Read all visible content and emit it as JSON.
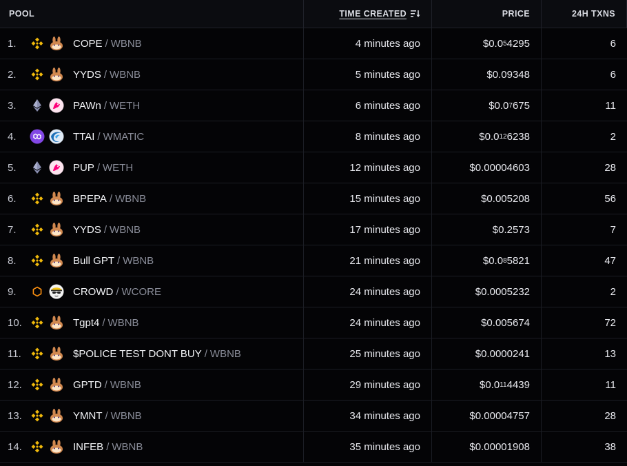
{
  "header": {
    "pool": "POOL",
    "time_created": "TIME CREATED",
    "price": "PRICE",
    "txns": "24H TXNS"
  },
  "colors": {
    "bnb": "#F0B90B",
    "eth": "#7b7f9a",
    "polygon": "#8247E5",
    "core": "#FF9211",
    "pancake": "#D1884F"
  },
  "rows": [
    {
      "rank": "1.",
      "chain_icon": "bnb-icon",
      "dex_icon": "pancakeswap-icon",
      "base": "COPE",
      "quote": "WBNB",
      "time": "4 minutes ago",
      "price_pre": "$0.0",
      "price_sub": "5",
      "price_post": "4295",
      "txns": "6"
    },
    {
      "rank": "2.",
      "chain_icon": "bnb-icon",
      "dex_icon": "pancakeswap-icon",
      "base": "YYDS",
      "quote": "WBNB",
      "time": "5 minutes ago",
      "price_pre": "$0.09348",
      "price_sub": "",
      "price_post": "",
      "txns": "6"
    },
    {
      "rank": "3.",
      "chain_icon": "ethereum-icon",
      "dex_icon": "uniswap-icon",
      "base": "PAWn",
      "quote": "WETH",
      "time": "6 minutes ago",
      "price_pre": "$0.0",
      "price_sub": "7",
      "price_post": "675",
      "txns": "11"
    },
    {
      "rank": "4.",
      "chain_icon": "polygon-icon",
      "dex_icon": "quickswap-icon",
      "base": "TTAI",
      "quote": "WMATIC",
      "time": "8 minutes ago",
      "price_pre": "$0.0",
      "price_sub": "12",
      "price_post": "6238",
      "txns": "2"
    },
    {
      "rank": "5.",
      "chain_icon": "ethereum-icon",
      "dex_icon": "uniswap-icon",
      "base": "PUP",
      "quote": "WETH",
      "time": "12 minutes ago",
      "price_pre": "$0.00004603",
      "price_sub": "",
      "price_post": "",
      "txns": "28"
    },
    {
      "rank": "6.",
      "chain_icon": "bnb-icon",
      "dex_icon": "pancakeswap-icon",
      "base": "BPEPA",
      "quote": "WBNB",
      "time": "15 minutes ago",
      "price_pre": "$0.005208",
      "price_sub": "",
      "price_post": "",
      "txns": "56"
    },
    {
      "rank": "7.",
      "chain_icon": "bnb-icon",
      "dex_icon": "pancakeswap-icon",
      "base": "YYDS",
      "quote": "WBNB",
      "time": "17 minutes ago",
      "price_pre": "$0.2573",
      "price_sub": "",
      "price_post": "",
      "txns": "7"
    },
    {
      "rank": "8.",
      "chain_icon": "bnb-icon",
      "dex_icon": "pancakeswap-icon",
      "base": "Bull GPT",
      "quote": "WBNB",
      "time": "21 minutes ago",
      "price_pre": "$0.0",
      "price_sub": "8",
      "price_post": "5821",
      "txns": "47"
    },
    {
      "rank": "9.",
      "chain_icon": "core-icon",
      "dex_icon": "shadowswap-icon",
      "base": "CROWD",
      "quote": "WCORE",
      "time": "24 minutes ago",
      "price_pre": "$0.0005232",
      "price_sub": "",
      "price_post": "",
      "txns": "2"
    },
    {
      "rank": "10.",
      "chain_icon": "bnb-icon",
      "dex_icon": "pancakeswap-icon",
      "base": "Tgpt4",
      "quote": "WBNB",
      "time": "24 minutes ago",
      "price_pre": "$0.005674",
      "price_sub": "",
      "price_post": "",
      "txns": "72"
    },
    {
      "rank": "11.",
      "chain_icon": "bnb-icon",
      "dex_icon": "pancakeswap-icon",
      "base": "$POLICE TEST DONT BUY",
      "quote": "WBNB",
      "time": "25 minutes ago",
      "price_pre": "$0.0000241",
      "price_sub": "",
      "price_post": "",
      "txns": "13"
    },
    {
      "rank": "12.",
      "chain_icon": "bnb-icon",
      "dex_icon": "pancakeswap-icon",
      "base": "GPTD",
      "quote": "WBNB",
      "time": "29 minutes ago",
      "price_pre": "$0.0",
      "price_sub": "11",
      "price_post": "4439",
      "txns": "11"
    },
    {
      "rank": "13.",
      "chain_icon": "bnb-icon",
      "dex_icon": "pancakeswap-icon",
      "base": "YMNT",
      "quote": "WBNB",
      "time": "34 minutes ago",
      "price_pre": "$0.00004757",
      "price_sub": "",
      "price_post": "",
      "txns": "28"
    },
    {
      "rank": "14.",
      "chain_icon": "bnb-icon",
      "dex_icon": "pancakeswap-icon",
      "base": "INFEB",
      "quote": "WBNB",
      "time": "35 minutes ago",
      "price_pre": "$0.00001908",
      "price_sub": "",
      "price_post": "",
      "txns": "38"
    }
  ]
}
